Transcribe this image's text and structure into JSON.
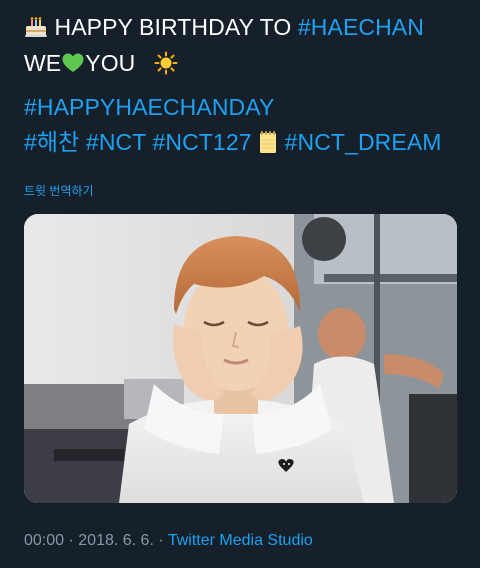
{
  "tweet": {
    "line1": {
      "text": "HAPPY BIRTHDAY TO",
      "hashtag": "#HAECHAN"
    },
    "line2": {
      "we": "WE",
      "you": "YOU"
    },
    "hashtag_main": "#HAPPYHAECHANDAY",
    "hashtags": [
      "#해찬",
      "#NCT",
      "#NCT127",
      "#NCT_DREAM"
    ],
    "translate": "트윗 번역하기",
    "meta": {
      "time": "00:00",
      "date": "2018. 6. 6.",
      "source": "Twitter Media Studio",
      "sep": "·"
    }
  },
  "colors": {
    "background": "#15202b",
    "link": "#1da1f2",
    "muted": "#8899a6"
  },
  "icons": [
    "birthday-cake-icon",
    "green-heart-icon",
    "sun-icon",
    "notepad-icon"
  ]
}
